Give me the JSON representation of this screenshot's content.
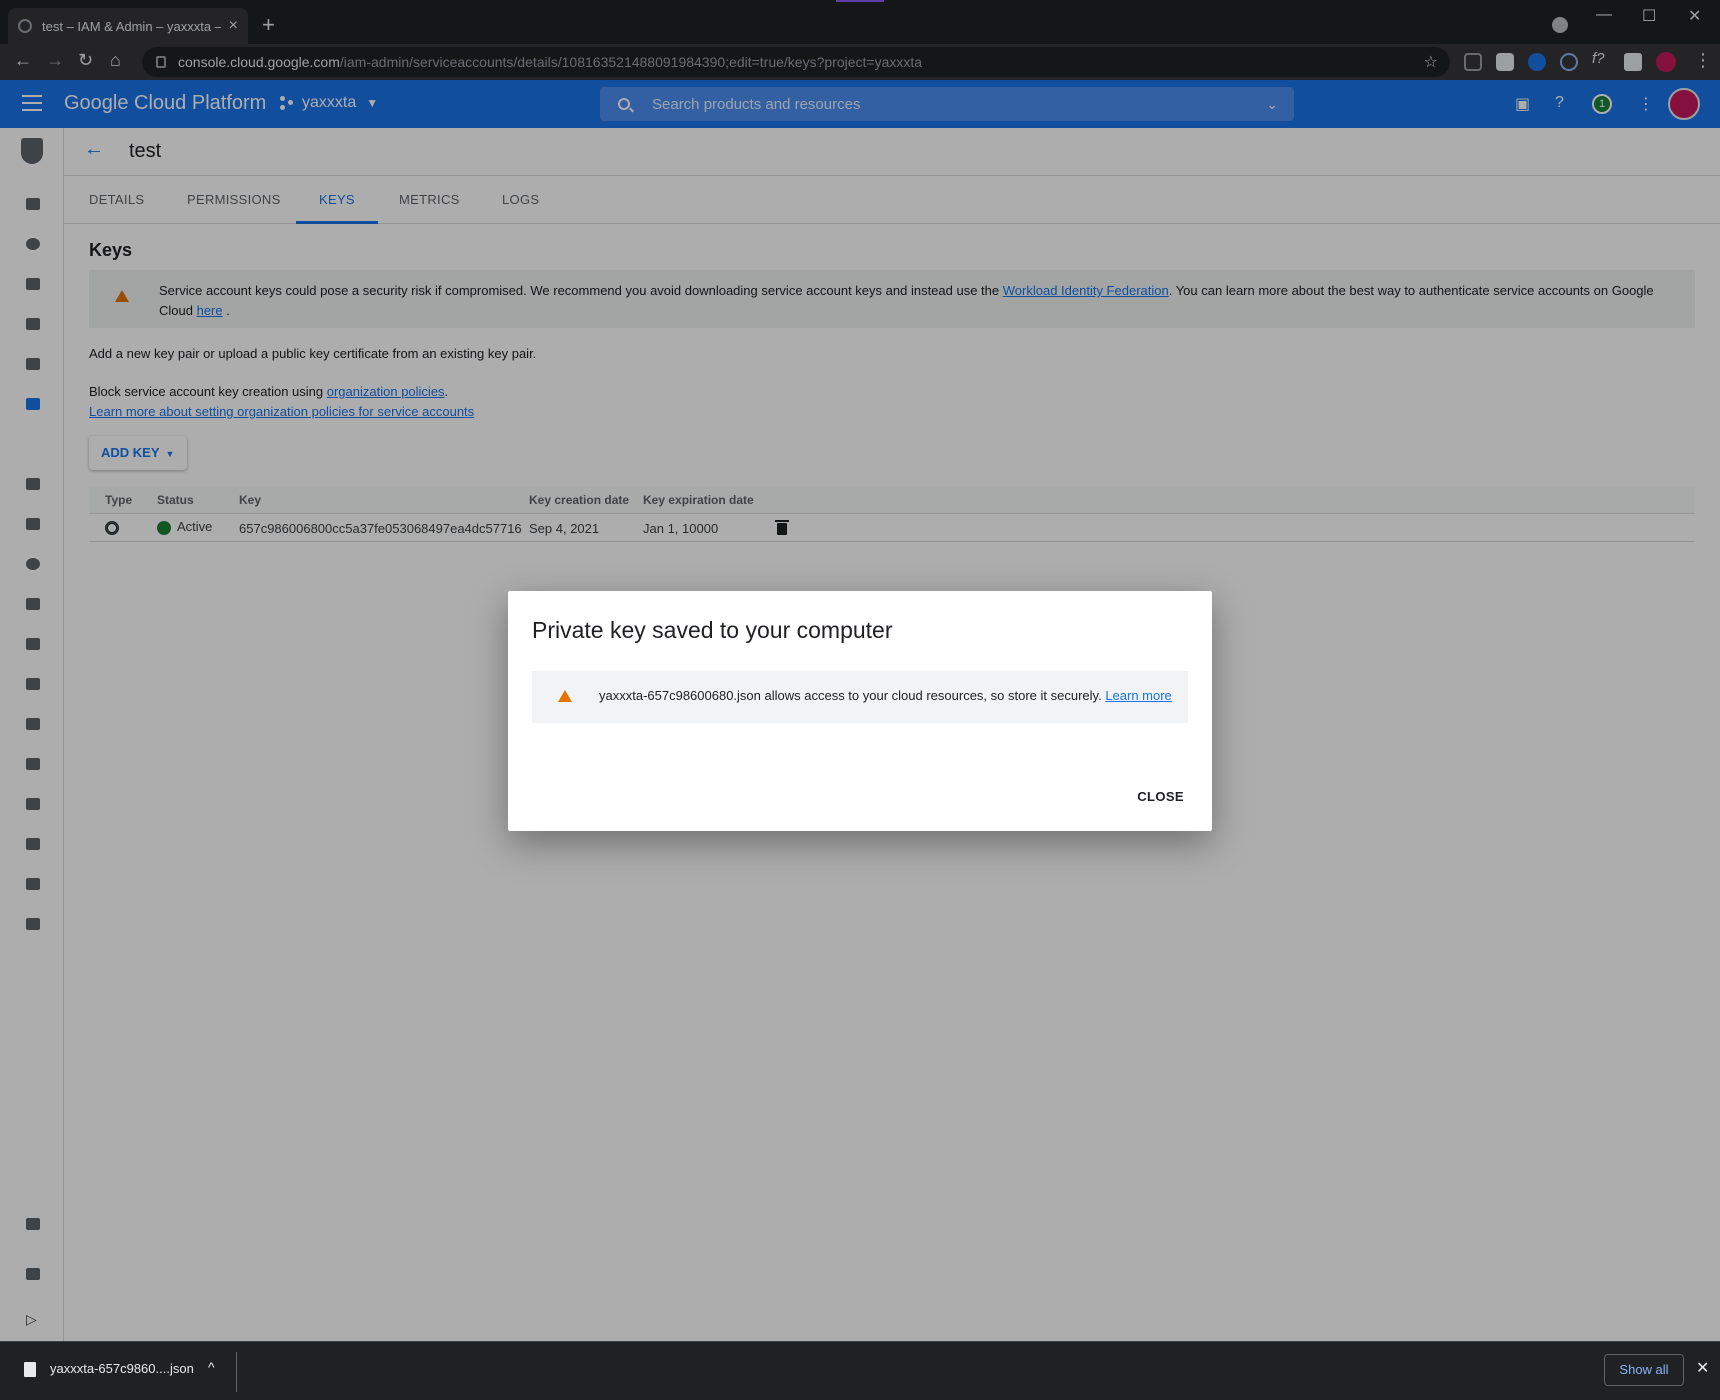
{
  "browser": {
    "tab_title": "test – IAM & Admin – yaxxxta – C",
    "url_host": "console.cloud.google.com",
    "url_path": "/iam-admin/serviceaccounts/details/108163521488091984390;edit=true/keys?project=yaxxxta"
  },
  "header": {
    "brand": "Google Cloud Platform",
    "project": "yaxxxta",
    "search_placeholder": "Search products and resources",
    "notification_count": "1"
  },
  "page": {
    "title": "test",
    "tabs": [
      "DETAILS",
      "PERMISSIONS",
      "KEYS",
      "METRICS",
      "LOGS"
    ],
    "active_tab": "KEYS",
    "section_title": "Keys",
    "warning": {
      "text_before": "Service account keys could pose a security risk if compromised. We recommend you avoid downloading service account keys and instead use the",
      "link1": "Workload Identity Federation",
      "text_middle": ". You can learn more about the best way to authenticate service accounts on Google Cloud",
      "link2": "here",
      "text_after": "."
    },
    "intro": "Add a new key pair or upload a public key certificate from an existing key pair.",
    "block_text": "Block service account key creation using",
    "block_link": "organization policies",
    "block_period": ".",
    "learn_link": "Learn more about setting organization policies for service accounts",
    "add_key_label": "ADD KEY"
  },
  "table": {
    "headers": {
      "type": "Type",
      "status": "Status",
      "key": "Key",
      "created": "Key creation date",
      "expires": "Key expiration date"
    },
    "rows": [
      {
        "status": "Active",
        "key": "657c986006800cc5a37fe053068497ea4dc57716",
        "created": "Sep 4, 2021",
        "expires": "Jan 1, 10000"
      }
    ]
  },
  "dialog": {
    "title": "Private key saved to your computer",
    "message": "yaxxxta-657c98600680.json allows access to your cloud resources, so store it securely.",
    "learn_more": "Learn more",
    "close_label": "CLOSE"
  },
  "download_shelf": {
    "filename": "yaxxxta-657c9860....json",
    "show_all": "Show all"
  },
  "colors": {
    "brand_blue": "#1a73e8",
    "warning_orange": "#e37400",
    "active_green": "#188038"
  }
}
